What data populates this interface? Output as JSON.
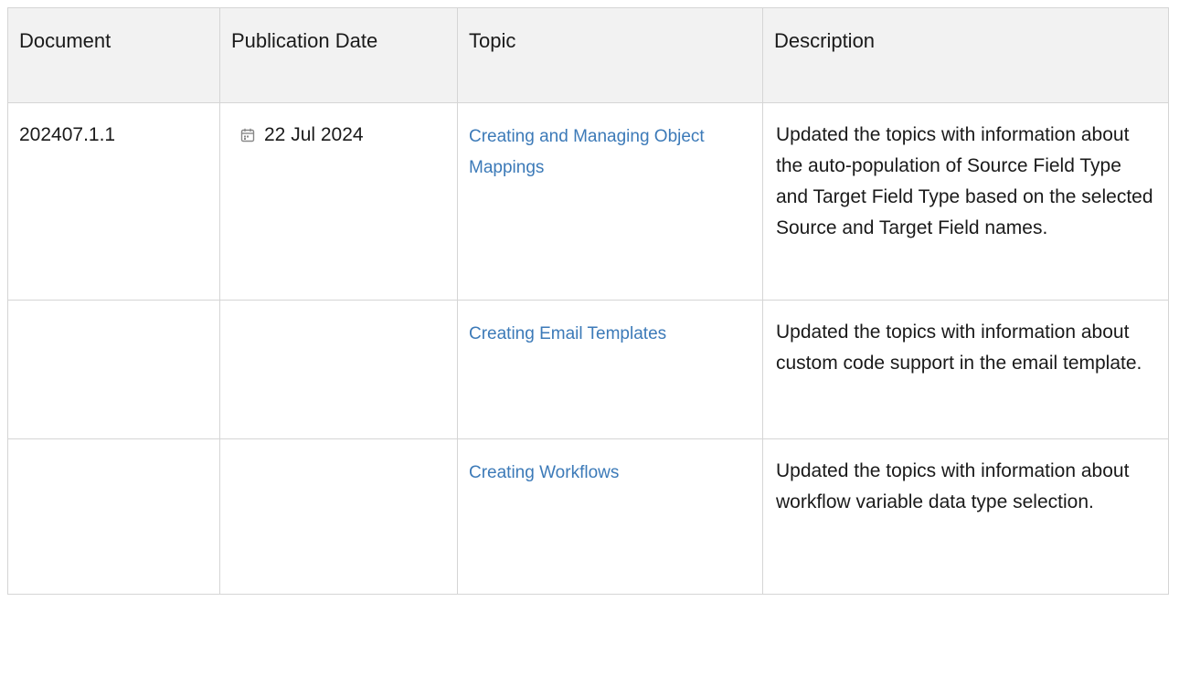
{
  "table": {
    "headers": [
      "Document",
      "Publication Date",
      "Topic",
      "Description"
    ],
    "rows": [
      {
        "document": "202407.1.1",
        "date": "22 Jul 2024",
        "date_icon": "calendar-icon",
        "topic": "Creating and Managing Object Mappings",
        "description": "Updated the topics with information about the auto-population of Source Field Type and Target Field Type based on the selected Source and Target Field names."
      },
      {
        "document": "",
        "date": "",
        "topic": "Creating Email Templates",
        "description": "Updated the topics with information about custom code support in the email template."
      },
      {
        "document": "",
        "date": "",
        "topic": "Creating Workflows",
        "description": "Updated the topics with information about workflow variable data type selection."
      }
    ]
  },
  "colors": {
    "header_bg": "#f2f2f2",
    "border": "#d5d5d5",
    "link": "#3c7ab8",
    "text": "#1a1a1a"
  }
}
